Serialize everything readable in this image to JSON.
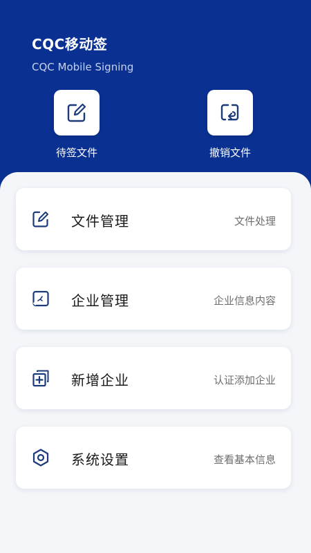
{
  "header": {
    "title": "CQC移动签",
    "subtitle": "CQC Mobile Signing"
  },
  "quick_actions": [
    {
      "label": "待签文件",
      "icon": "edit-document-icon"
    },
    {
      "label": "撤销文件",
      "icon": "revoke-document-icon"
    }
  ],
  "menu": [
    {
      "title": "文件管理",
      "subtitle": "文件处理",
      "icon": "edit-document-icon"
    },
    {
      "title": "企业管理",
      "subtitle": "企业信息内容",
      "icon": "enterprise-icon"
    },
    {
      "title": "新增企业",
      "subtitle": "认证添加企业",
      "icon": "add-enterprise-icon"
    },
    {
      "title": "系统设置",
      "subtitle": "查看基本信息",
      "icon": "settings-icon"
    }
  ],
  "colors": {
    "brand": "#0A3192",
    "icon": "#1B3A7A",
    "background": "#F4F6FA"
  }
}
